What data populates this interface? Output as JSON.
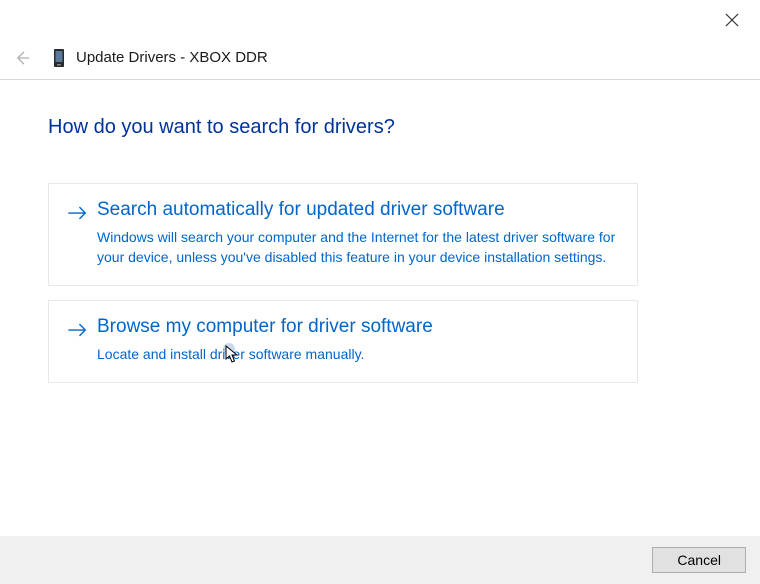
{
  "header": {
    "title": "Update Drivers - XBOX DDR"
  },
  "heading": "How do you want to search for drivers?",
  "options": [
    {
      "title": "Search automatically for updated driver software",
      "desc": "Windows will search your computer and the Internet for the latest driver software for your device, unless you've disabled this feature in your device installation settings."
    },
    {
      "title": "Browse my computer for driver software",
      "desc": "Locate and install driver software manually."
    }
  ],
  "footer": {
    "cancel": "Cancel"
  }
}
